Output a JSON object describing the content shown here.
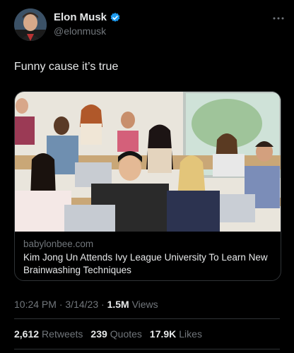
{
  "author": {
    "display_name": "Elon Musk",
    "handle": "@elonmusk"
  },
  "tweet": {
    "text": "Funny cause it’s true"
  },
  "card": {
    "domain": "babylonbee.com",
    "title": "Kim Jong Un Attends Ivy League University To Learn New Brainwashing Techniques"
  },
  "meta": {
    "time": "10:24 PM",
    "sep1": "·",
    "date": "3/14/23",
    "sep2": "·",
    "views_count": "1.5M",
    "views_label": "Views"
  },
  "stats": {
    "retweets_count": "2,612",
    "retweets_label": "Retweets",
    "quotes_count": "239",
    "quotes_label": "Quotes",
    "likes_count": "17.9K",
    "likes_label": "Likes"
  },
  "colors": {
    "background": "#000000",
    "text": "#e7e9ea",
    "muted": "#71767b",
    "verified": "#1d9bf0",
    "border": "#2f3336"
  }
}
